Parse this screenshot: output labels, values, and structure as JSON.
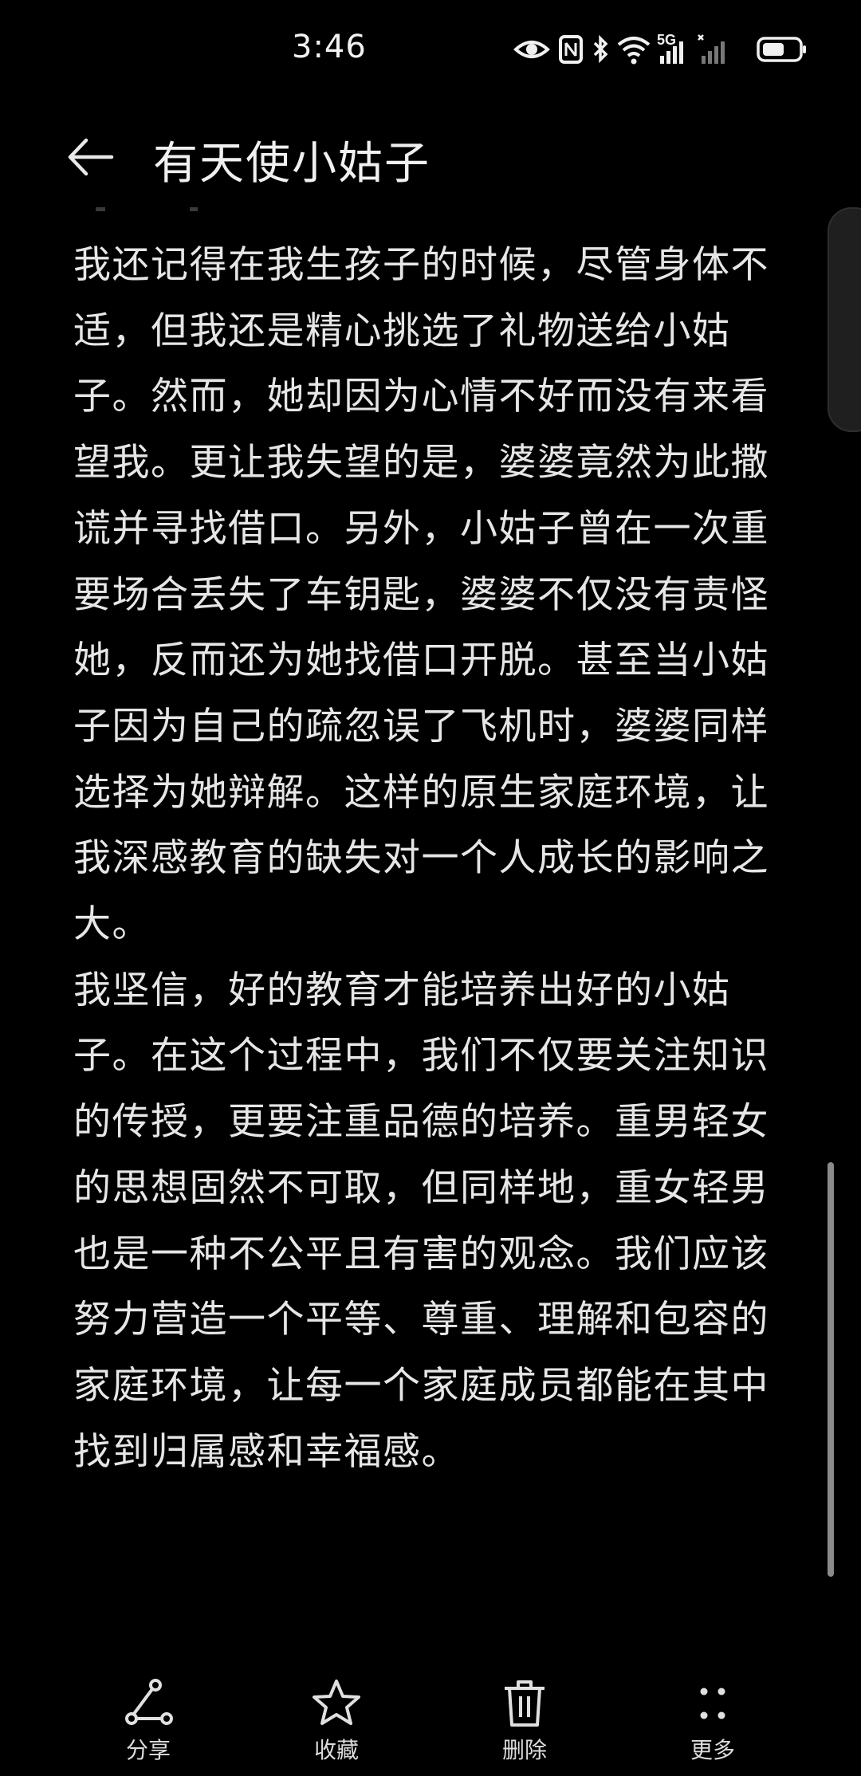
{
  "status_bar": {
    "time": "3:46",
    "icons": [
      "eye-icon",
      "nfc-icon",
      "bluetooth-icon",
      "wifi-icon",
      "signal-5g-icon",
      "signal-icon",
      "battery-icon"
    ],
    "network_label": "5G"
  },
  "header": {
    "title": "有天使小姑子",
    "back_icon": "arrow-left-icon"
  },
  "content": {
    "paragraphs": [
      "我还记得在我生孩子的时候，尽管身体不适，但我还是精心挑选了礼物送给小姑子。然而，她却因为心情不好而没有来看望我。更让我失望的是，婆婆竟然为此撒谎并寻找借口。另外，小姑子曾在一次重要场合丢失了车钥匙，婆婆不仅没有责怪她，反而还为她找借口开脱。甚至当小姑子因为自己的疏忽误了飞机时，婆婆同样选择为她辩解。这样的原生家庭环境，让我深感教育的缺失对一个人成长的影响之大。",
      "我坚信，好的教育才能培养出好的小姑子。在这个过程中，我们不仅要关注知识的传授，更要注重品德的培养。重男轻女的思想固然不可取，但同样地，重女轻男也是一种不公平且有害的观念。我们应该努力营造一个平等、尊重、理解和包容的家庭环境，让每一个家庭成员都能在其中找到归属感和幸福感。"
    ]
  },
  "bottom_bar": {
    "actions": [
      {
        "label": "分享",
        "icon": "share-icon"
      },
      {
        "label": "收藏",
        "icon": "star-icon"
      },
      {
        "label": "删除",
        "icon": "trash-icon"
      },
      {
        "label": "更多",
        "icon": "more-dots-icon"
      }
    ]
  },
  "colors": {
    "background": "#000000",
    "text": "#e6e6e6",
    "icon": "#e0e0e0"
  }
}
